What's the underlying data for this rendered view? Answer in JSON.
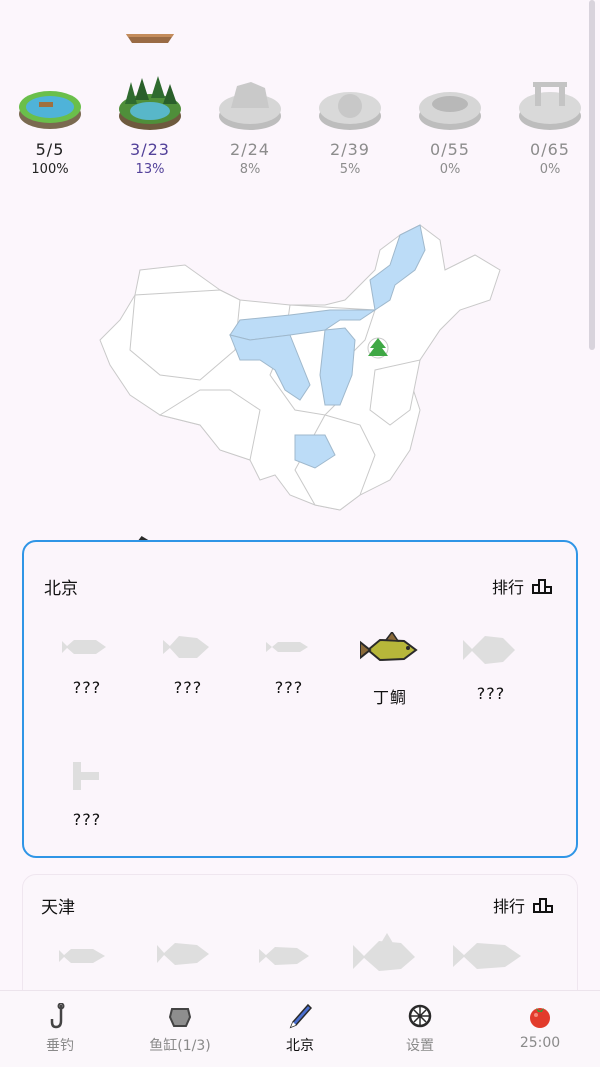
{
  "levels": [
    {
      "count": "5/5",
      "pct": "100%",
      "state": "done",
      "icon": "pond-island-icon"
    },
    {
      "count": "3/23",
      "pct": "13%",
      "state": "active",
      "icon": "forest-lake-icon"
    },
    {
      "count": "2/24",
      "pct": "8%",
      "state": "locked",
      "icon": "locked-stage-icon"
    },
    {
      "count": "2/39",
      "pct": "5%",
      "state": "locked",
      "icon": "locked-stage-icon"
    },
    {
      "count": "0/55",
      "pct": "0%",
      "state": "locked",
      "icon": "locked-stage-icon"
    },
    {
      "count": "0/65",
      "pct": "0%",
      "state": "locked",
      "icon": "locked-stage-icon"
    }
  ],
  "selected_region": {
    "title": "北京",
    "rank_label": "排行",
    "fish": [
      {
        "name": "???",
        "discovered": false
      },
      {
        "name": "???",
        "discovered": false
      },
      {
        "name": "???",
        "discovered": false
      },
      {
        "name": "丁鲷",
        "discovered": true
      },
      {
        "name": "???",
        "discovered": false
      },
      {
        "name": "???",
        "discovered": false
      }
    ]
  },
  "second_region": {
    "title": "天津",
    "rank_label": "排行"
  },
  "tabs": [
    {
      "label": "垂钓",
      "icon": "fishing-hook-icon"
    },
    {
      "label": "鱼缸(1/3)",
      "icon": "fish-tank-icon"
    },
    {
      "label": "北京",
      "icon": "fishing-float-icon"
    },
    {
      "label": "设置",
      "icon": "settings-icon"
    },
    {
      "label": "25:00",
      "icon": "tomato-timer-icon"
    }
  ],
  "colors": {
    "accent": "#2f95e6",
    "progress_purple": "#53429a",
    "map_highlight": "#bcdcf7"
  }
}
